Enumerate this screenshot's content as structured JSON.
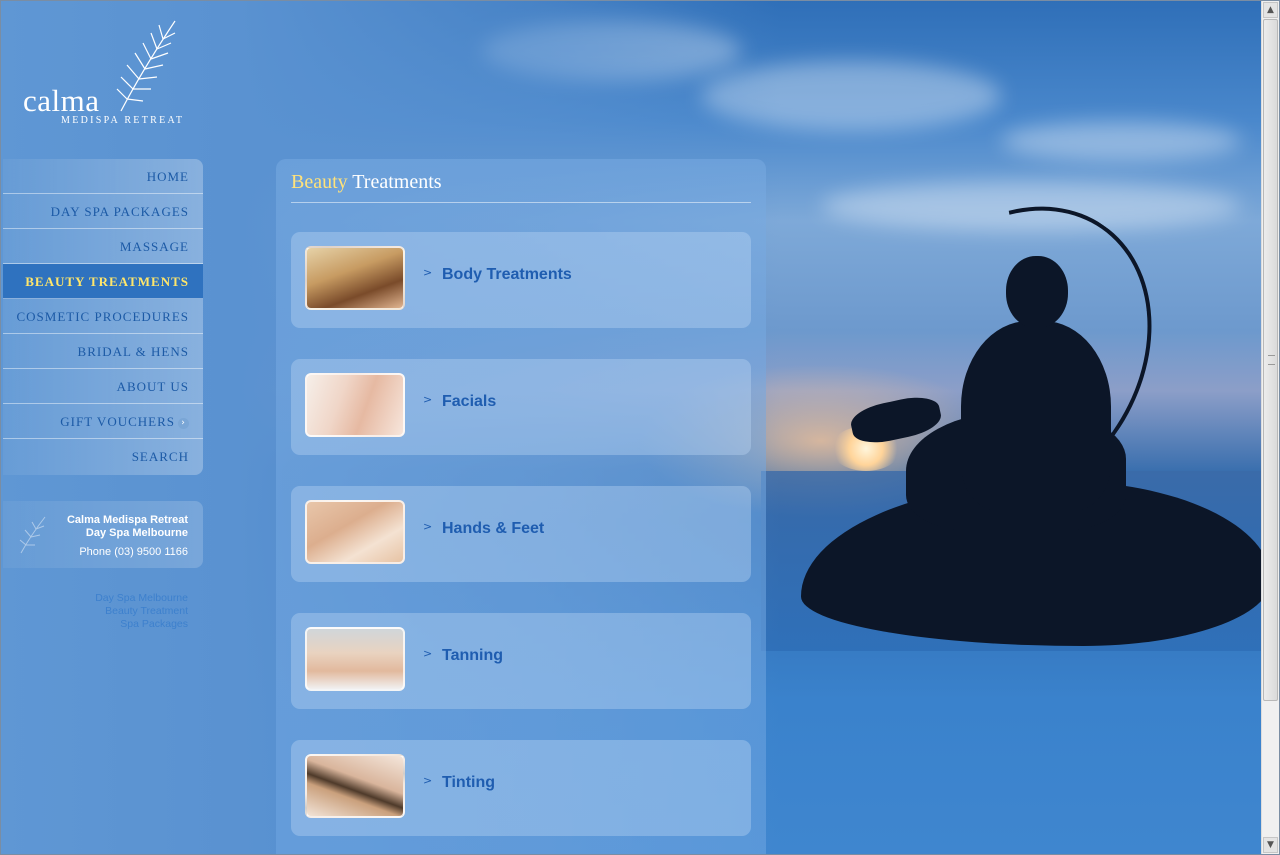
{
  "logo": {
    "name": "calma",
    "subtitle": "MEDISPA RETREAT"
  },
  "nav": {
    "items": [
      {
        "label": "HOME"
      },
      {
        "label": "DAY SPA PACKAGES"
      },
      {
        "label": "MASSAGE"
      },
      {
        "label": "BEAUTY TREATMENTS",
        "active": true
      },
      {
        "label": "COSMETIC PROCEDURES"
      },
      {
        "label": "BRIDAL & HENS"
      },
      {
        "label": "ABOUT US"
      },
      {
        "label": "GIFT VOUCHERS"
      },
      {
        "label": "SEARCH"
      }
    ]
  },
  "contact": {
    "line1": "Calma Medispa Retreat",
    "line2": "Day Spa Melbourne",
    "phone": "Phone (03) 9500 1166"
  },
  "seo_links": [
    "Day Spa Melbourne",
    "Beauty Treatment",
    "Spa Packages"
  ],
  "page": {
    "heading_accent": "Beauty",
    "heading_rest": "Treatments"
  },
  "treatments": [
    {
      "label": "Body Treatments",
      "image": "massage-photo"
    },
    {
      "label": "Facials",
      "image": "facial-photo"
    },
    {
      "label": "Hands & Feet",
      "image": "pedicure-photo"
    },
    {
      "label": "Tanning",
      "image": "tanning-photo"
    },
    {
      "label": "Tinting",
      "image": "eye-tinting-photo"
    }
  ],
  "colors": {
    "accent_yellow": "#ffe27a",
    "nav_text": "#1c5aa6",
    "active_bg": "#2f72bf",
    "link_blue": "#1f5db0"
  }
}
